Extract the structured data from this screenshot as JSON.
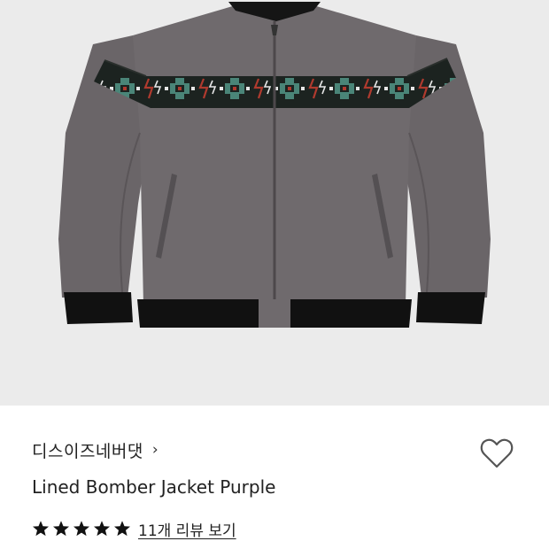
{
  "product": {
    "image": {
      "alt": "Lined Bomber Jacket Purple",
      "background": "#ebebeb",
      "body_color": "#6f6a6d",
      "rib_color": "#111111",
      "band_colors": [
        "#1c2320",
        "#4a8578",
        "#b03a2e",
        "#e7e7e7"
      ]
    },
    "brand": {
      "name": "디스이즈네버댓",
      "chevron": "›"
    },
    "title": "Lined Bomber Jacket Purple",
    "wishlist": {
      "icon": "heart-outline-icon",
      "liked": false
    },
    "rating": {
      "stars": 5,
      "max_stars": 5
    },
    "review_link": "11개 리뷰 보기"
  }
}
